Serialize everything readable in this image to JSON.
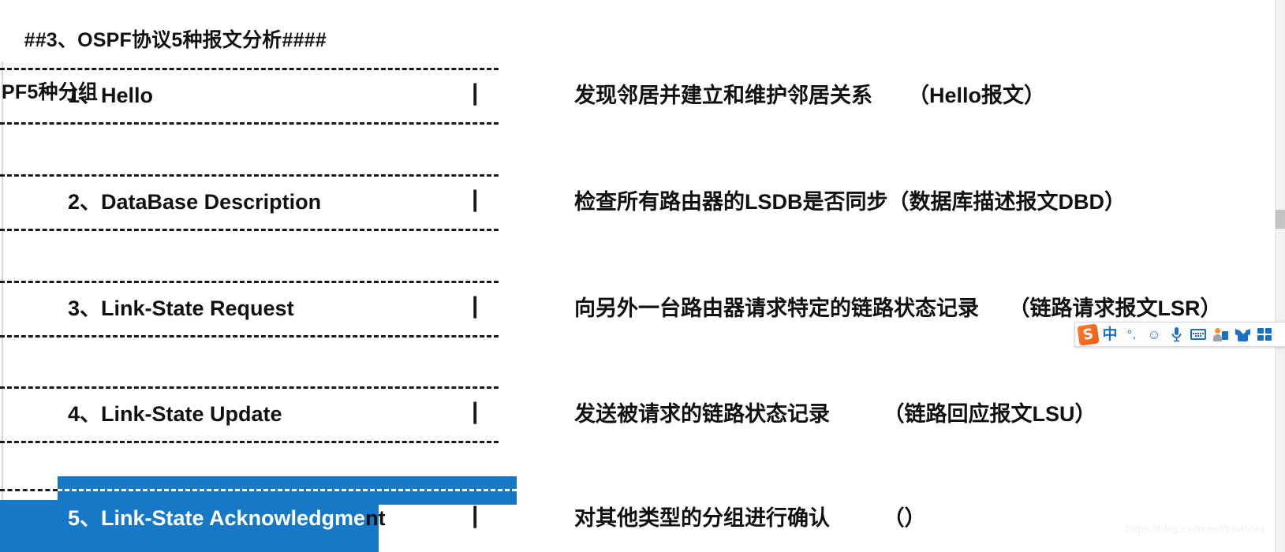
{
  "document": {
    "heading_line1": "##3、OSPF协议5种报文分析####",
    "heading_line2": "PF5种分组",
    "rows": [
      {
        "left": "1、Hello",
        "separator": "|",
        "right": "发现邻居并建立和维护邻居关系      （Hello报文）"
      },
      {
        "left": "2、DataBase Description",
        "separator": "|",
        "right": "检查所有路由器的LSDB是否同步（数据库描述报文DBD）"
      },
      {
        "left": "3、Link-State Request",
        "separator": "|",
        "right": "向另外一台路由器请求特定的链路状态记录     （链路请求报文LSR）"
      },
      {
        "left": "4、Link-State Update",
        "separator": "|",
        "right": "发送被请求的链路状态记录         （链路回应报文LSU）"
      },
      {
        "left_selected": "5、Link-State Acknowledgme",
        "left_unselected": "nt",
        "separator": "|",
        "right": "对其他类型的分组进行确认         （）"
      }
    ],
    "watermark": "https://blog.csdn.net/Liwlbolu",
    "selection_color": "#1878c8"
  },
  "ime": {
    "logo_label": "S",
    "mode_label": "中",
    "punctuation_label": "°,",
    "emoji_label": "☺",
    "voice_label": "🎤",
    "keyboard_label": "soft-keyboard",
    "account_label": "user-account",
    "skin_label": "skin",
    "toolbox_label": "toolbox"
  },
  "scrollbar": {
    "thumb_label": "vertical-scroll-thumb"
  }
}
